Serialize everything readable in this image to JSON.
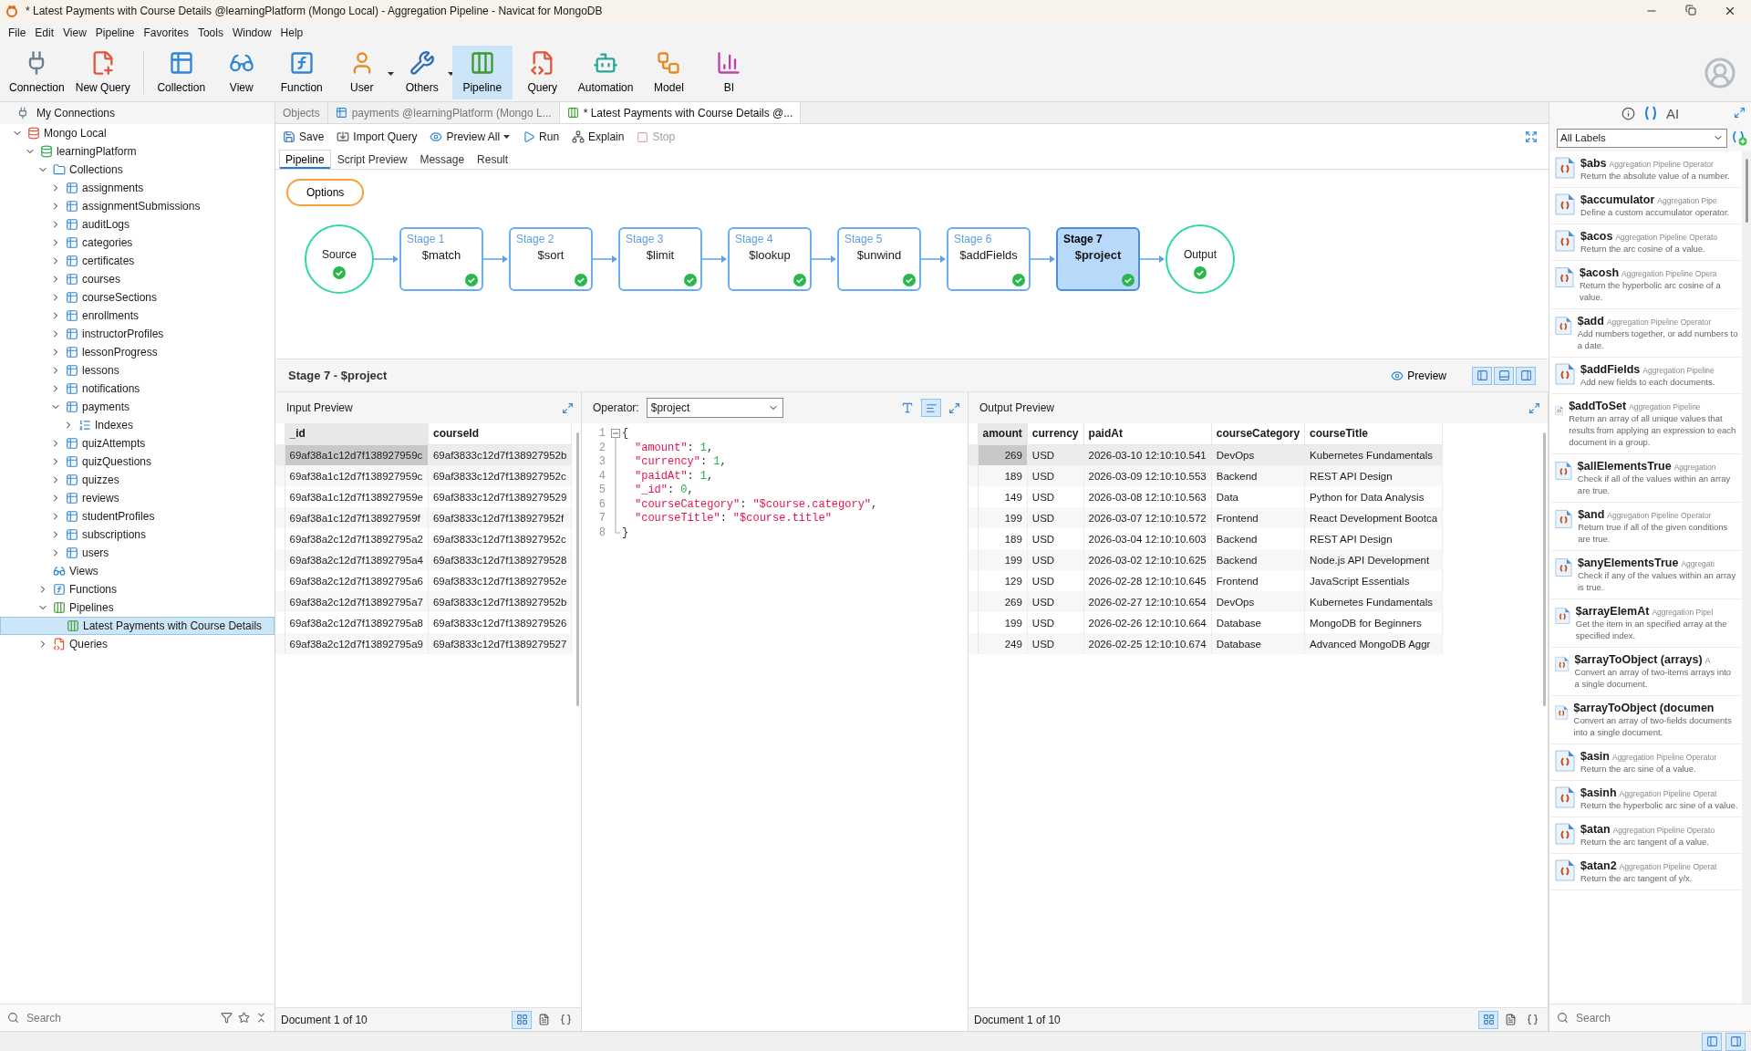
{
  "window": {
    "title": "* Latest Payments with Course Details @learningPlatform (Mongo Local) - Aggregation Pipeline - Navicat for MongoDB"
  },
  "menu": [
    "File",
    "Edit",
    "View",
    "Pipeline",
    "Favorites",
    "Tools",
    "Window",
    "Help"
  ],
  "toolbar": [
    {
      "label": "Connection",
      "selected": false,
      "dropdown": false
    },
    {
      "label": "New Query",
      "selected": false,
      "dropdown": false
    },
    {
      "label": "Collection",
      "selected": false,
      "dropdown": false
    },
    {
      "label": "View",
      "selected": false,
      "dropdown": false
    },
    {
      "label": "Function",
      "selected": false,
      "dropdown": false
    },
    {
      "label": "User",
      "selected": false,
      "dropdown": true
    },
    {
      "label": "Others",
      "selected": false,
      "dropdown": true
    },
    {
      "label": "Pipeline",
      "selected": true,
      "dropdown": false
    },
    {
      "label": "Query",
      "selected": false,
      "dropdown": false
    },
    {
      "label": "Automation",
      "selected": false,
      "dropdown": false
    },
    {
      "label": "Model",
      "selected": false,
      "dropdown": false
    },
    {
      "label": "BI",
      "selected": false,
      "dropdown": false
    }
  ],
  "sidebar": {
    "header": "My Connections",
    "tree": [
      {
        "label": "Mongo Local",
        "kind": "connection",
        "expanded": true,
        "selected": false,
        "children": [
          {
            "label": "learningPlatform",
            "kind": "database",
            "expanded": true,
            "selected": false,
            "children": [
              {
                "label": "Collections",
                "kind": "collections",
                "expanded": true,
                "selected": false,
                "children": [
                  {
                    "label": "assignments",
                    "kind": "collection",
                    "expanded": false,
                    "selected": false
                  },
                  {
                    "label": "assignmentSubmissions",
                    "kind": "collection",
                    "expanded": false,
                    "selected": false
                  },
                  {
                    "label": "auditLogs",
                    "kind": "collection",
                    "expanded": false,
                    "selected": false
                  },
                  {
                    "label": "categories",
                    "kind": "collection",
                    "expanded": false,
                    "selected": false
                  },
                  {
                    "label": "certificates",
                    "kind": "collection",
                    "expanded": false,
                    "selected": false
                  },
                  {
                    "label": "courses",
                    "kind": "collection",
                    "expanded": false,
                    "selected": false
                  },
                  {
                    "label": "courseSections",
                    "kind": "collection",
                    "expanded": false,
                    "selected": false
                  },
                  {
                    "label": "enrollments",
                    "kind": "collection",
                    "expanded": false,
                    "selected": false
                  },
                  {
                    "label": "instructorProfiles",
                    "kind": "collection",
                    "expanded": false,
                    "selected": false
                  },
                  {
                    "label": "lessonProgress",
                    "kind": "collection",
                    "expanded": false,
                    "selected": false
                  },
                  {
                    "label": "lessons",
                    "kind": "collection",
                    "expanded": false,
                    "selected": false
                  },
                  {
                    "label": "notifications",
                    "kind": "collection",
                    "expanded": false,
                    "selected": false
                  },
                  {
                    "label": "payments",
                    "kind": "collection",
                    "expanded": true,
                    "selected": false,
                    "children": [
                      {
                        "label": "Indexes",
                        "kind": "indexes",
                        "expanded": false,
                        "selected": false
                      }
                    ]
                  },
                  {
                    "label": "quizAttempts",
                    "kind": "collection",
                    "expanded": false,
                    "selected": false
                  },
                  {
                    "label": "quizQuestions",
                    "kind": "collection",
                    "expanded": false,
                    "selected": false
                  },
                  {
                    "label": "quizzes",
                    "kind": "collection",
                    "expanded": false,
                    "selected": false
                  },
                  {
                    "label": "reviews",
                    "kind": "collection",
                    "expanded": false,
                    "selected": false
                  },
                  {
                    "label": "studentProfiles",
                    "kind": "collection",
                    "expanded": false,
                    "selected": false
                  },
                  {
                    "label": "subscriptions",
                    "kind": "collection",
                    "expanded": false,
                    "selected": false
                  },
                  {
                    "label": "users",
                    "kind": "collection",
                    "expanded": false,
                    "selected": false
                  }
                ]
              },
              {
                "label": "Views",
                "kind": "views",
                "selected": false
              },
              {
                "label": "Functions",
                "kind": "functions",
                "expanded": false,
                "selected": false
              },
              {
                "label": "Pipelines",
                "kind": "pipelines",
                "expanded": true,
                "selected": false,
                "children": [
                  {
                    "label": "Latest Payments with Course Details",
                    "kind": "pipeline",
                    "selected": true
                  }
                ]
              },
              {
                "label": "Queries",
                "kind": "queries",
                "expanded": false,
                "selected": false
              }
            ]
          }
        ]
      }
    ],
    "search": {
      "placeholder": "Search"
    }
  },
  "doc_tabs": [
    {
      "label": "Objects",
      "kind": "objects",
      "selected": false
    },
    {
      "label": "payments @learningPlatform (Mongo L...",
      "kind": "collection",
      "selected": false
    },
    {
      "label": "* Latest Payments with Course Details @...",
      "kind": "pipeline",
      "selected": true
    }
  ],
  "editor_toolbar": [
    {
      "label": "Save",
      "kind": "save",
      "disabled": false,
      "dropdown": false
    },
    {
      "label": "Import Query",
      "kind": "import",
      "disabled": false,
      "dropdown": false
    },
    {
      "label": "Preview All",
      "kind": "preview",
      "disabled": false,
      "dropdown": true
    },
    {
      "label": "Run",
      "kind": "run",
      "disabled": false,
      "dropdown": false
    },
    {
      "label": "Explain",
      "kind": "explain",
      "disabled": false,
      "dropdown": false
    },
    {
      "label": "Stop",
      "kind": "stop",
      "disabled": true,
      "dropdown": false
    }
  ],
  "sub_tabs": [
    {
      "label": "Pipeline",
      "selected": true
    },
    {
      "label": "Script Preview",
      "selected": false
    },
    {
      "label": "Message",
      "selected": false
    },
    {
      "label": "Result",
      "selected": false
    }
  ],
  "options_button": "Options",
  "stages": [
    {
      "kind": "source",
      "label": "Source",
      "ok": true,
      "selected": false
    },
    {
      "kind": "stage",
      "title": "Stage 1",
      "label": "$match",
      "ok": true,
      "selected": false
    },
    {
      "kind": "stage",
      "title": "Stage 2",
      "label": "$sort",
      "ok": true,
      "selected": false
    },
    {
      "kind": "stage",
      "title": "Stage 3",
      "label": "$limit",
      "ok": true,
      "selected": false
    },
    {
      "kind": "stage",
      "title": "Stage 4",
      "label": "$lookup",
      "ok": true,
      "selected": false
    },
    {
      "kind": "stage",
      "title": "Stage 5",
      "label": "$unwind",
      "ok": true,
      "selected": false
    },
    {
      "kind": "stage",
      "title": "Stage 6",
      "label": "$addFields",
      "ok": true,
      "selected": false
    },
    {
      "kind": "stage",
      "title": "Stage 7",
      "label": "$project",
      "ok": true,
      "selected": true
    },
    {
      "kind": "output",
      "label": "Output",
      "ok": true,
      "selected": false
    }
  ],
  "stage_panel": {
    "title": "Stage 7 - $project",
    "preview_label": "Preview"
  },
  "input_preview": {
    "title": "Input Preview",
    "columns": [
      "_id",
      "courseId"
    ],
    "rows": [
      {
        "selected": true,
        "cells": [
          "69af38a1c12d7f138927959c",
          "69af3833c12d7f138927952b"
        ]
      },
      {
        "selected": false,
        "cells": [
          "69af38a1c12d7f138927959c",
          "69af3833c12d7f138927952c"
        ]
      },
      {
        "selected": false,
        "cells": [
          "69af38a1c12d7f138927959e",
          "69af3833c12d7f1389279529"
        ]
      },
      {
        "selected": false,
        "cells": [
          "69af38a1c12d7f138927959f",
          "69af3833c12d7f138927952f"
        ]
      },
      {
        "selected": false,
        "cells": [
          "69af38a2c12d7f13892795a2",
          "69af3833c12d7f138927952c"
        ]
      },
      {
        "selected": false,
        "cells": [
          "69af38a2c12d7f13892795a4",
          "69af3833c12d7f1389279528"
        ]
      },
      {
        "selected": false,
        "cells": [
          "69af38a2c12d7f13892795a6",
          "69af3833c12d7f138927952e"
        ]
      },
      {
        "selected": false,
        "cells": [
          "69af38a2c12d7f13892795a7",
          "69af3833c12d7f138927952b"
        ]
      },
      {
        "selected": false,
        "cells": [
          "69af38a2c12d7f13892795a8",
          "69af3833c12d7f1389279526"
        ]
      },
      {
        "selected": false,
        "cells": [
          "69af38a2c12d7f13892795a9",
          "69af3833c12d7f1389279527"
        ]
      }
    ],
    "footer": "Document 1 of 10"
  },
  "operator": {
    "label": "Operator:",
    "value": "$project"
  },
  "code": [
    {
      "number": "1",
      "indented": false,
      "tokens": [
        {
          "kind": "punct",
          "text": "{"
        }
      ]
    },
    {
      "number": "2",
      "indented": true,
      "tokens": [
        {
          "kind": "key",
          "text": "\"amount\""
        },
        {
          "kind": "punct",
          "text": ":"
        },
        {
          "kind": "number",
          "text": "1"
        },
        {
          "kind": "punct",
          "text": ","
        }
      ]
    },
    {
      "number": "3",
      "indented": true,
      "tokens": [
        {
          "kind": "key",
          "text": "\"currency\""
        },
        {
          "kind": "punct",
          "text": ":"
        },
        {
          "kind": "number",
          "text": "1"
        },
        {
          "kind": "punct",
          "text": ","
        }
      ]
    },
    {
      "number": "4",
      "indented": true,
      "tokens": [
        {
          "kind": "key",
          "text": "\"paidAt\""
        },
        {
          "kind": "punct",
          "text": ":"
        },
        {
          "kind": "number",
          "text": "1"
        },
        {
          "kind": "punct",
          "text": ","
        }
      ]
    },
    {
      "number": "5",
      "indented": true,
      "tokens": [
        {
          "kind": "key",
          "text": "\"_id\""
        },
        {
          "kind": "punct",
          "text": ":"
        },
        {
          "kind": "number",
          "text": "0"
        },
        {
          "kind": "punct",
          "text": ","
        }
      ]
    },
    {
      "number": "6",
      "indented": true,
      "tokens": [
        {
          "kind": "key",
          "text": "\"courseCategory\""
        },
        {
          "kind": "punct",
          "text": ":"
        },
        {
          "kind": "string",
          "text": "\"$course.category\""
        },
        {
          "kind": "punct",
          "text": ","
        }
      ]
    },
    {
      "number": "7",
      "indented": true,
      "tokens": [
        {
          "kind": "key",
          "text": "\"courseTitle\""
        },
        {
          "kind": "punct",
          "text": ":"
        },
        {
          "kind": "string",
          "text": "\"$course.title\""
        }
      ]
    },
    {
      "number": "8",
      "indented": false,
      "tokens": [
        {
          "kind": "punct",
          "text": "}"
        }
      ]
    }
  ],
  "output_preview": {
    "title": "Output Preview",
    "columns": [
      "amount",
      "currency",
      "paidAt",
      "courseCategory",
      "courseTitle"
    ],
    "rows": [
      {
        "selected": true,
        "cells": [
          "269",
          "USD",
          "2026-03-10 12:10:10.541",
          "DevOps",
          "Kubernetes Fundamentals"
        ]
      },
      {
        "selected": false,
        "cells": [
          "189",
          "USD",
          "2026-03-09 12:10:10.553",
          "Backend",
          "REST API Design"
        ]
      },
      {
        "selected": false,
        "cells": [
          "149",
          "USD",
          "2026-03-08 12:10:10.563",
          "Data",
          "Python for Data Analysis"
        ]
      },
      {
        "selected": false,
        "cells": [
          "199",
          "USD",
          "2026-03-07 12:10:10.572",
          "Frontend",
          "React Development Bootca"
        ]
      },
      {
        "selected": false,
        "cells": [
          "189",
          "USD",
          "2026-03-04 12:10:10.603",
          "Backend",
          "REST API Design"
        ]
      },
      {
        "selected": false,
        "cells": [
          "199",
          "USD",
          "2026-03-02 12:10:10.625",
          "Backend",
          "Node.js API Development"
        ]
      },
      {
        "selected": false,
        "cells": [
          "129",
          "USD",
          "2026-02-28 12:10:10.645",
          "Frontend",
          "JavaScript Essentials"
        ]
      },
      {
        "selected": false,
        "cells": [
          "269",
          "USD",
          "2026-02-27 12:10:10.654",
          "DevOps",
          "Kubernetes Fundamentals"
        ]
      },
      {
        "selected": false,
        "cells": [
          "199",
          "USD",
          "2026-02-26 12:10:10.664",
          "Database",
          "MongoDB for Beginners"
        ]
      },
      {
        "selected": false,
        "cells": [
          "249",
          "USD",
          "2026-02-25 12:10:10.674",
          "Database",
          "Advanced MongoDB Aggr"
        ]
      }
    ],
    "footer": "Document 1 of 10"
  },
  "right_panel": {
    "tabs": [
      {
        "kind": "info",
        "selected": false
      },
      {
        "kind": "operators",
        "selected": true
      },
      {
        "kind": "ai",
        "label": "AI",
        "selected": false
      }
    ],
    "filter": "All Labels",
    "operators": [
      {
        "name": "$abs",
        "category": "Aggregation Pipeline Operator",
        "description": "Return the absolute value of a number."
      },
      {
        "name": "$accumulator",
        "category": "Aggregation Pipe",
        "description": "Define a custom accumulator operator."
      },
      {
        "name": "$acos",
        "category": "Aggregation Pipeline Operato",
        "description": "Return the arc cosine of a value."
      },
      {
        "name": "$acosh",
        "category": "Aggregation Pipeline Opera",
        "description": "Return the hyperbolic arc cosine of a value."
      },
      {
        "name": "$add",
        "category": "Aggregation Pipeline Operator",
        "description": "Add numbers together, or add numbers to a date."
      },
      {
        "name": "$addFields",
        "category": "Aggregation Pipeline",
        "description": "Add new fields to each documents."
      },
      {
        "name": "$addToSet",
        "category": "Aggregation Pipeline",
        "description": "Return an array of all unique values that results from applying an expression to each document in a group."
      },
      {
        "name": "$allElementsTrue",
        "category": "Aggregation",
        "description": "Check if all of the values within an array are true."
      },
      {
        "name": "$and",
        "category": "Aggregation Pipeline Operator",
        "description": "Return true if all of the given conditions are true."
      },
      {
        "name": "$anyElementsTrue",
        "category": "Aggregati",
        "description": "Check if any of the values within an array is true."
      },
      {
        "name": "$arrayElemAt",
        "category": "Aggregation Pipel",
        "description": "Get the item in an specified array at the specified index."
      },
      {
        "name": "$arrayToObject (arrays)",
        "category": "A",
        "description": "Convert an array of two-items arrays into a single document."
      },
      {
        "name": "$arrayToObject (documen",
        "description": "Convert an array of two-fields documents into a single document."
      },
      {
        "name": "$asin",
        "category": "Aggregation Pipeline Operator",
        "description": "Return the arc sine of a value."
      },
      {
        "name": "$asinh",
        "category": "Aggregation Pipeline Operat",
        "description": "Return the hyperbolic arc sine of a value."
      },
      {
        "name": "$atan",
        "category": "Aggregation Pipeline Operato",
        "description": "Return the arc tangent of a value."
      },
      {
        "name": "$atan2",
        "category": "Aggregation Pipeline Operat",
        "description": "Return the arc tangent of y/x."
      }
    ],
    "search": {
      "placeholder": "Search"
    }
  }
}
